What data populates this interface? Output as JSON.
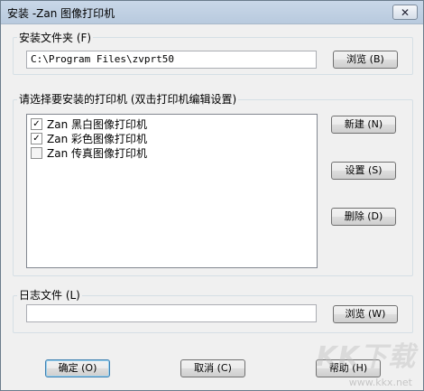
{
  "window": {
    "title": "安装 -Zan 图像打印机",
    "close_glyph": "✕"
  },
  "install_folder": {
    "label": "安装文件夹 (F)",
    "path": "C:\\Program Files\\zvprt50",
    "browse_label": "浏览 (B)"
  },
  "printers": {
    "label": "请选择要安装的打印机 (双击打印机编辑设置)",
    "items": [
      {
        "label": "Zan 黑白图像打印机",
        "checked": true
      },
      {
        "label": "Zan 彩色图像打印机",
        "checked": true
      },
      {
        "label": "Zan 传真图像打印机",
        "checked": false
      }
    ],
    "new_label": "新建 (N)",
    "settings_label": "设置 (S)",
    "delete_label": "删除 (D)"
  },
  "log_file": {
    "label": "日志文件 (L)",
    "path": "",
    "browse_label": "浏览 (W)"
  },
  "footer": {
    "ok_label": "确定 (O)",
    "cancel_label": "取消 (C)",
    "help_label": "帮助 (H)"
  },
  "watermark": {
    "text": "KK下载",
    "url": "www.kkx.net"
  },
  "colors": {
    "titlebar": "#c9d7e8",
    "dialog_bg": "#f0f0f0",
    "default_button_border": "#3c7fb1"
  }
}
